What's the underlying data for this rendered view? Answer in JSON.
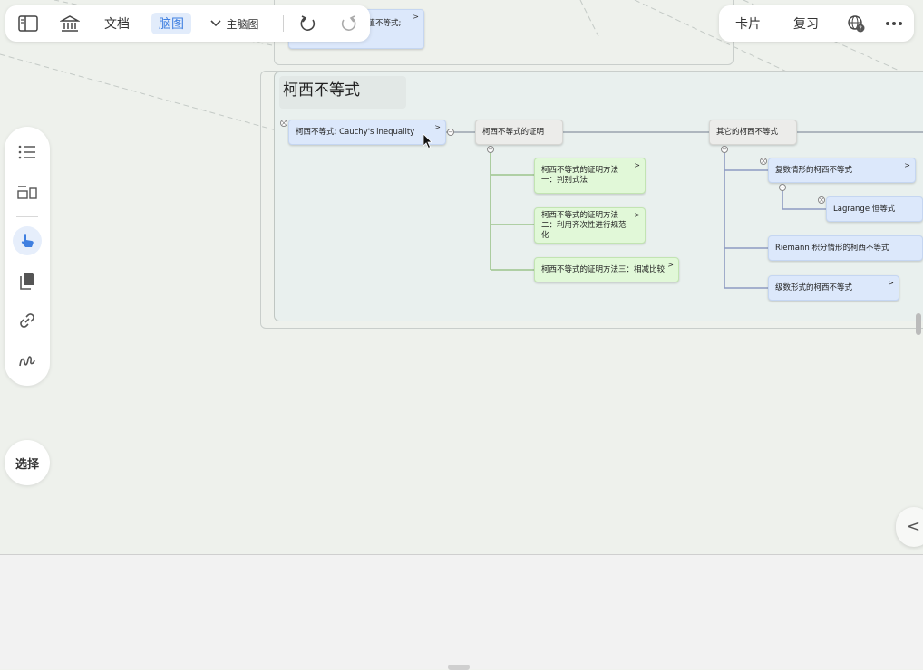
{
  "toolbar": {
    "docs_label": "文档",
    "mindmap_label": "脑图",
    "main_mindmap_label": "主脑图"
  },
  "right_toolbar": {
    "card_label": "卡片",
    "review_label": "复习"
  },
  "select_label": "选择",
  "mindmap": {
    "upper_fragment": "的值不等式; 基",
    "group_title": "柯西不等式",
    "root": "柯西不等式; Cauchy's inequality",
    "proof": "柯西不等式的证明",
    "proof_methods": [
      "柯西不等式的证明方法一：判别式法",
      "柯西不等式的证明方法二：利用齐次性进行规范化",
      "柯西不等式的证明方法三：相减比较"
    ],
    "other": "其它的柯西不等式",
    "others": [
      "复数情形的柯西不等式",
      "Lagrange 恒等式",
      "Riemann 积分情形的柯西不等式",
      "级数形式的柯西不等式"
    ]
  },
  "colors": {
    "blue_node": "#dce8fb",
    "green_node": "#e1f8d8",
    "gray_node": "#ececea",
    "accent": "#3f7fe0"
  }
}
